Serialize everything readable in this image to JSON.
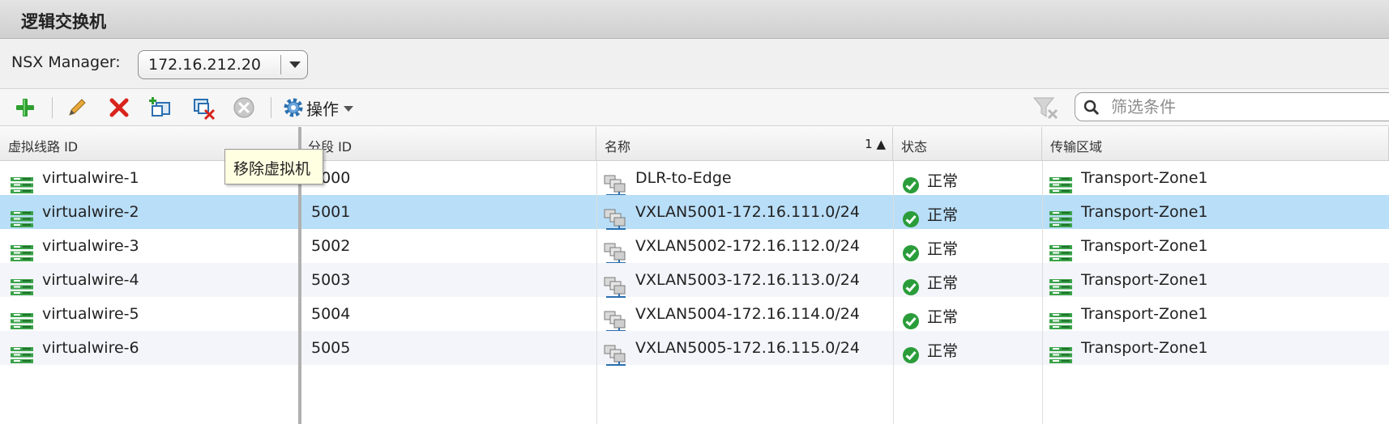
{
  "panel": {
    "title": "逻辑交换机"
  },
  "manager": {
    "label": "NSX Manager:",
    "selected": "172.16.212.20"
  },
  "toolbar": {
    "icons": [
      "add-icon",
      "edit-icon",
      "delete-icon",
      "add-vm-icon",
      "remove-vm-icon",
      "disabled-icon"
    ],
    "actions_label": "操作",
    "tooltip": "移除虚拟机"
  },
  "search": {
    "placeholder": "筛选条件"
  },
  "table": {
    "columns": [
      "虚拟线路 ID",
      "分段 ID",
      "名称",
      "状态",
      "传输区域"
    ],
    "sort_indicator": "1 ▲",
    "rows": [
      {
        "wire_id": "virtualwire-1",
        "segment_id": "5000",
        "name": "DLR-to-Edge",
        "status": "正常",
        "zone": "Transport-Zone1"
      },
      {
        "wire_id": "virtualwire-2",
        "segment_id": "5001",
        "name": "VXLAN5001-172.16.111.0/24",
        "status": "正常",
        "zone": "Transport-Zone1"
      },
      {
        "wire_id": "virtualwire-3",
        "segment_id": "5002",
        "name": "VXLAN5002-172.16.112.0/24",
        "status": "正常",
        "zone": "Transport-Zone1"
      },
      {
        "wire_id": "virtualwire-4",
        "segment_id": "5003",
        "name": "VXLAN5003-172.16.113.0/24",
        "status": "正常",
        "zone": "Transport-Zone1"
      },
      {
        "wire_id": "virtualwire-5",
        "segment_id": "5004",
        "name": "VXLAN5004-172.16.114.0/24",
        "status": "正常",
        "zone": "Transport-Zone1"
      },
      {
        "wire_id": "virtualwire-6",
        "segment_id": "5005",
        "name": "VXLAN5005-172.16.115.0/24",
        "status": "正常",
        "zone": "Transport-Zone1"
      }
    ]
  },
  "colors": {
    "selected_row": "#b9def8",
    "status_ok": "#2a9d3a",
    "add": "#2e9e2e",
    "delete": "#d8241d"
  }
}
